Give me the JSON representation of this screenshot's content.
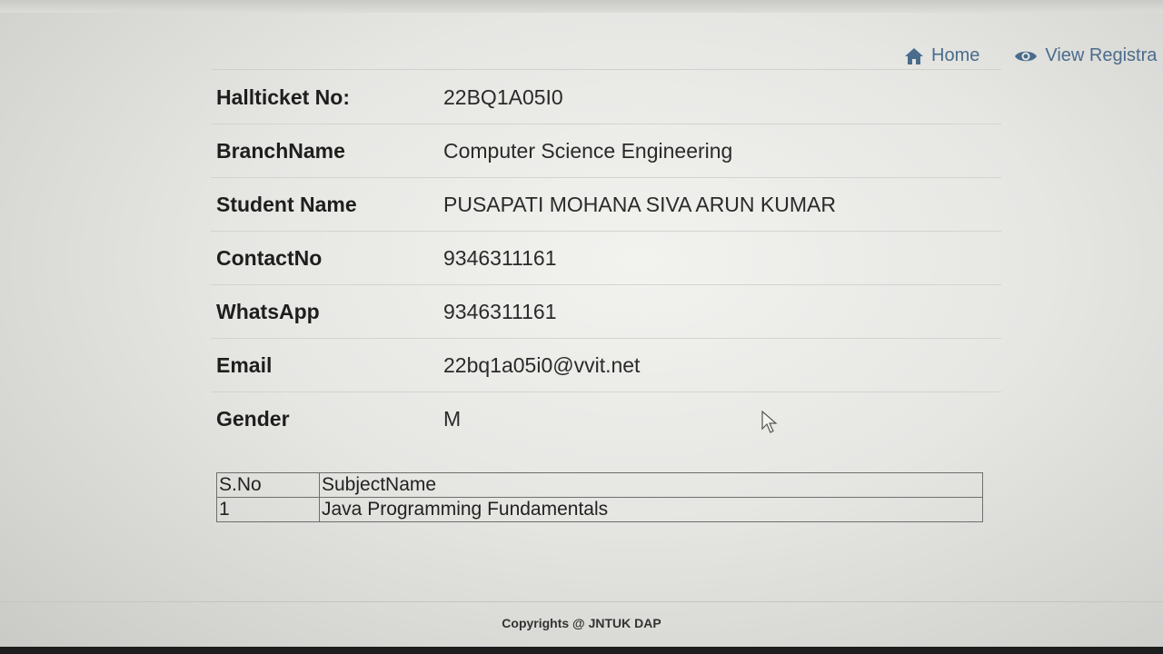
{
  "nav": {
    "home_label": "Home",
    "view_label": "View Registra"
  },
  "details": [
    {
      "label": "Hallticket No:",
      "value": "22BQ1A05I0"
    },
    {
      "label": "BranchName",
      "value": "Computer Science Engineering"
    },
    {
      "label": "Student Name",
      "value": "PUSAPATI MOHANA SIVA ARUN KUMAR"
    },
    {
      "label": "ContactNo",
      "value": "9346311161"
    },
    {
      "label": "WhatsApp",
      "value": "9346311161"
    },
    {
      "label": "Email",
      "value": "22bq1a05i0@vvit.net"
    },
    {
      "label": "Gender",
      "value": "M"
    }
  ],
  "subjects_table": {
    "headers": [
      "S.No",
      "SubjectName"
    ],
    "rows": [
      [
        "1",
        "Java Programming Fundamentals"
      ]
    ]
  },
  "footer": {
    "copyright": "Copyrights @ JNTUK DAP"
  },
  "colors": {
    "nav_link": "#4a6c8c",
    "text": "#1e1e1e"
  }
}
